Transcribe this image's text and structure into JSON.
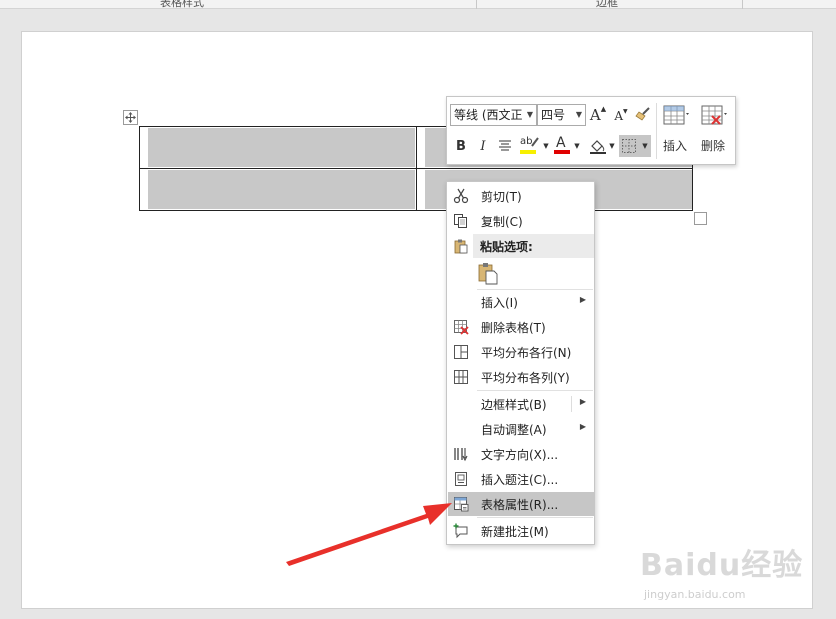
{
  "ribbon": {
    "group_left": "表格样式",
    "group_right": "边框"
  },
  "mini_toolbar": {
    "font_name": "等线 (西文正",
    "font_size": "四号",
    "grow_font": "A",
    "shrink_font": "A",
    "bold": "B",
    "italic": "I",
    "highlight": "ab",
    "font_color": "A",
    "insert_label": "插入",
    "delete_label": "删除",
    "colors": {
      "highlight": "#f7f000",
      "font_color": "#e00000"
    }
  },
  "context_menu": {
    "items": [
      {
        "label": "剪切(T)",
        "icon": "scissors-icon"
      },
      {
        "label": "复制(C)",
        "icon": "copy-icon"
      },
      {
        "label": "粘贴选项:",
        "icon": "clipboard-icon"
      },
      {
        "label": "插入(I)",
        "icon": "none"
      },
      {
        "label": "删除表格(T)",
        "icon": "delete-table-icon"
      },
      {
        "label": "平均分布各行(N)",
        "icon": "distribute-rows-icon"
      },
      {
        "label": "平均分布各列(Y)",
        "icon": "distribute-columns-icon"
      },
      {
        "label": "边框样式(B)",
        "icon": "none"
      },
      {
        "label": "自动调整(A)",
        "icon": "none"
      },
      {
        "label": "文字方向(X)...",
        "icon": "text-direction-icon"
      },
      {
        "label": "插入题注(C)...",
        "icon": "caption-icon"
      },
      {
        "label": "表格属性(R)...",
        "icon": "table-properties-icon"
      },
      {
        "label": "新建批注(M)",
        "icon": "new-comment-icon"
      }
    ]
  },
  "watermark": {
    "brand": "Baidu经验",
    "url": "jingyan.baidu.com"
  },
  "annotation": {
    "arrow_color": "#e8302a"
  }
}
